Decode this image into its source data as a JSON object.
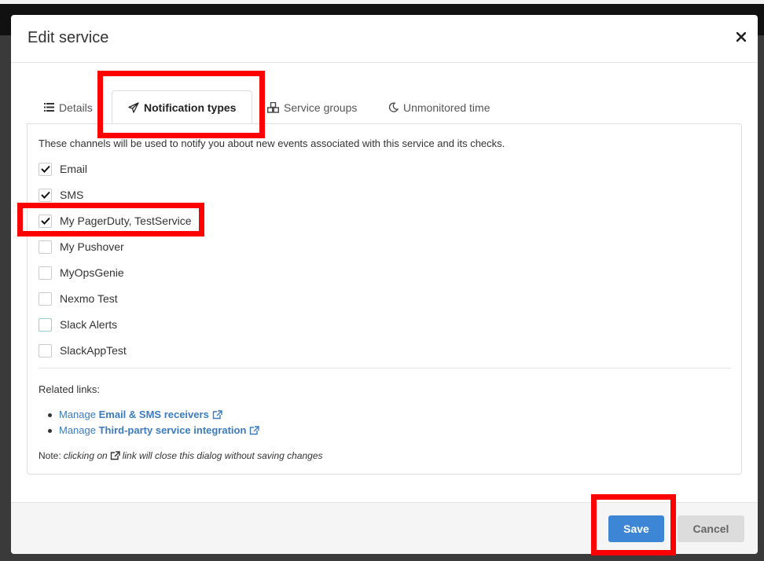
{
  "dialog": {
    "title": "Edit service",
    "close_symbol": "✕"
  },
  "tabs": [
    {
      "label": "Details",
      "icon": "list-icon"
    },
    {
      "label": "Notification types",
      "icon": "paper-plane-icon",
      "active": true
    },
    {
      "label": "Service groups",
      "icon": "cubes-icon"
    },
    {
      "label": "Unmonitored time",
      "icon": "moon-icon"
    }
  ],
  "panel": {
    "intro": "These channels will be used to notify you about new events associated with this service and its checks.",
    "channels": [
      {
        "label": "Email",
        "checked": true
      },
      {
        "label": "SMS",
        "checked": true
      },
      {
        "label": "My PagerDuty, TestService",
        "checked": true
      },
      {
        "label": "My Pushover",
        "checked": false
      },
      {
        "label": "MyOpsGenie",
        "checked": false
      },
      {
        "label": "Nexmo Test",
        "checked": false
      },
      {
        "label": "Slack Alerts",
        "checked": false
      },
      {
        "label": "SlackAppTest",
        "checked": false
      }
    ],
    "related_label": "Related links:",
    "links": [
      {
        "prefix": "Manage",
        "bold": "Email & SMS receivers"
      },
      {
        "prefix": "Manage",
        "bold": "Third-party service integration"
      }
    ],
    "note": {
      "prefix": "Note:",
      "italic_before": "clicking on",
      "italic_after": "link will close this dialog without saving changes"
    }
  },
  "footer": {
    "save_label": "Save",
    "cancel_label": "Cancel"
  },
  "colors": {
    "accent": "#3d86d5",
    "link": "#3b7bbf",
    "highlight": "#ff0000"
  }
}
